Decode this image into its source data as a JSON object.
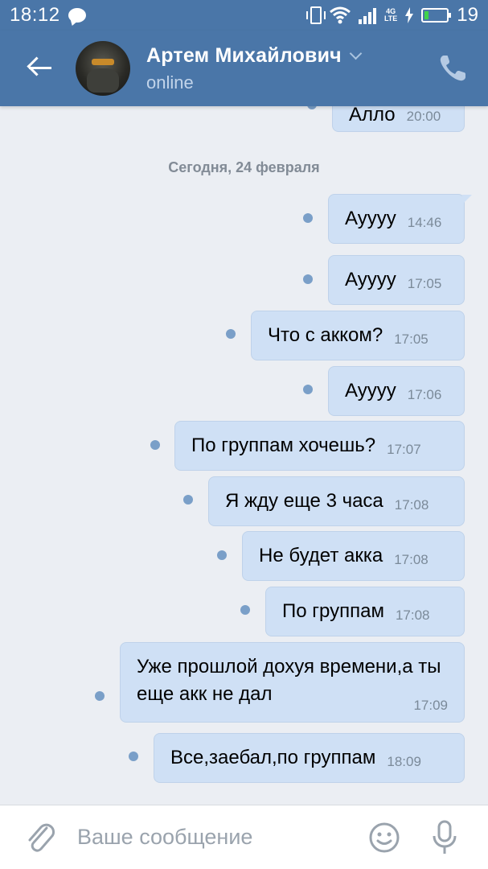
{
  "status_bar": {
    "time": "18:12",
    "battery_level": "19",
    "network_label_top": "4G",
    "network_label_bottom": "LTE",
    "battery_fill_color": "#3fd24b"
  },
  "header": {
    "contact_name": "Артем Михайлович",
    "contact_status": "online",
    "accent_color": "#4a76a8"
  },
  "conversation": {
    "date_separator": "Сегодня, 24 февраля",
    "previous_message": {
      "text": "Алло",
      "time": "20:00"
    },
    "messages": [
      {
        "text": "Ауууу",
        "time": "14:46"
      },
      {
        "text": "Ауууу",
        "time": "17:05"
      },
      {
        "text": "Что с акком?",
        "time": "17:05"
      },
      {
        "text": "Ауууу",
        "time": "17:06"
      },
      {
        "text": "По группам хочешь?",
        "time": "17:07"
      },
      {
        "text": "Я жду еще 3 часа",
        "time": "17:08"
      },
      {
        "text": "Не будет акка",
        "time": "17:08"
      },
      {
        "text": "По группам",
        "time": "17:08"
      },
      {
        "text": "Уже прошлой дохуя времени,а ты еще акк не дал",
        "time": "17:09"
      },
      {
        "text": "Все,заебал,по группам",
        "time": "18:09"
      }
    ]
  },
  "composer": {
    "placeholder": "Ваше сообщение"
  },
  "icons": {
    "back": "arrow-left-icon",
    "call": "phone-icon",
    "attach": "paperclip-icon",
    "emoji": "smiley-icon",
    "voice": "microphone-icon",
    "unread": "unread-dot-icon"
  }
}
